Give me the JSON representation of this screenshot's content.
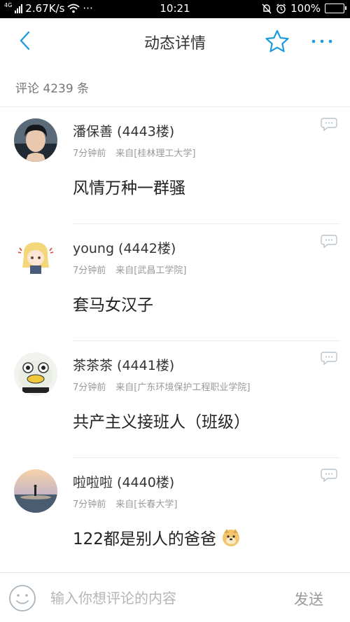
{
  "status_bar": {
    "network_type": "4G",
    "speed": "2.67K/s",
    "more": "···",
    "time": "10:21",
    "battery": "100%",
    "battery_level": 1.0
  },
  "header": {
    "title": "动态详情",
    "back_icon": "chevron-left-icon",
    "favorite_icon": "star-icon",
    "more_icon": "more-dots-icon",
    "accent_color": "#1e9bdc"
  },
  "comment_count": "评论 4239 条",
  "comments": [
    {
      "name": "潘保善 (4443楼)",
      "time": "7分钟前",
      "source": "来自[桂林理工大学]",
      "body": "风情万种一群骚",
      "avatar_icon": "avatar-photo-boy"
    },
    {
      "name": "young (4442楼)",
      "time": "7分钟前",
      "source": "来自[武昌工学院]",
      "body": "套马女汉子",
      "avatar_icon": "avatar-anime-girl"
    },
    {
      "name": "茶茶茶 (4441楼)",
      "time": "7分钟前",
      "source": "来自[广东环境保护工程职业学院]",
      "body": "共产主义接班人（班级）",
      "avatar_icon": "avatar-cartoon-face"
    },
    {
      "name": "啦啦啦 (4440楼)",
      "time": "7分钟前",
      "source": "来自[长春大学]",
      "body": "122都是别人的爸爸",
      "body_emoji": "doge-emoji",
      "avatar_icon": "avatar-beach-sunset"
    }
  ],
  "bottom_bar": {
    "emoji_icon": "smiley-icon",
    "input_placeholder": "输入你想评论的内容",
    "send_label": "发送"
  }
}
